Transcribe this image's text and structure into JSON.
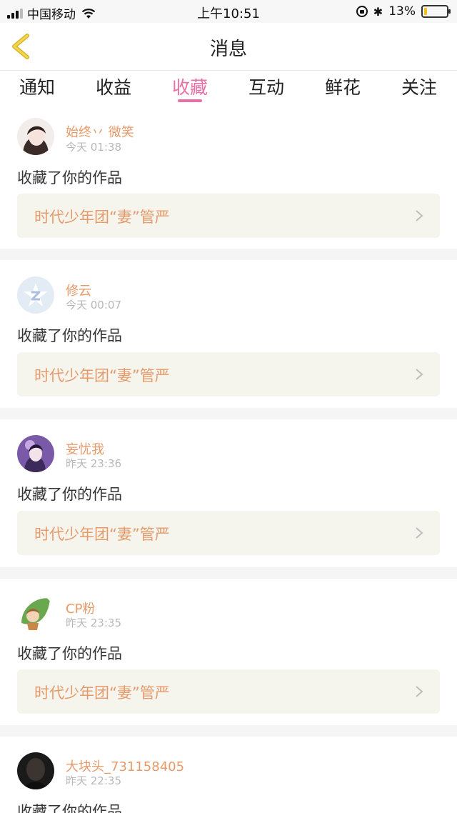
{
  "status_bar": {
    "carrier": "中国移动",
    "time": "上午10:51",
    "battery": "13%",
    "battery_level": 0.13
  },
  "header": {
    "title": "消息",
    "back_icon": "chevron-left-icon"
  },
  "tabs": [
    {
      "label": "通知",
      "active": false
    },
    {
      "label": "收益",
      "active": false
    },
    {
      "label": "收藏",
      "active": true
    },
    {
      "label": "互动",
      "active": false
    },
    {
      "label": "鲜花",
      "active": false
    },
    {
      "label": "关注",
      "active": false
    }
  ],
  "messages": [
    {
      "user": "始终丷 微笑",
      "time": "今天 01:38",
      "action": "收藏了你的作品",
      "work": "时代少年团“妻”管严",
      "avatar": "avatar-girl-white"
    },
    {
      "user": "修云",
      "time": "今天 00:07",
      "action": "收藏了你的作品",
      "work": "时代少年团“妻”管严",
      "avatar": "avatar-qq-default"
    },
    {
      "user": "妄忧我",
      "time": "昨天 23:36",
      "action": "收藏了你的作品",
      "work": "时代少年团“妻”管严",
      "avatar": "avatar-girl-purple"
    },
    {
      "user": "CP粉",
      "time": "昨天 23:35",
      "action": "收藏了你的作品",
      "work": "时代少年团“妻”管严",
      "avatar": "avatar-leaf-boy"
    },
    {
      "user": "大块头_731158405",
      "time": "昨天 22:35",
      "action": "收藏了你的作品",
      "work": "",
      "avatar": "avatar-dark-face"
    }
  ],
  "colors": {
    "accent": "#e96fa6",
    "name": "#e69a6a",
    "work_bg": "#f5f4ed"
  }
}
